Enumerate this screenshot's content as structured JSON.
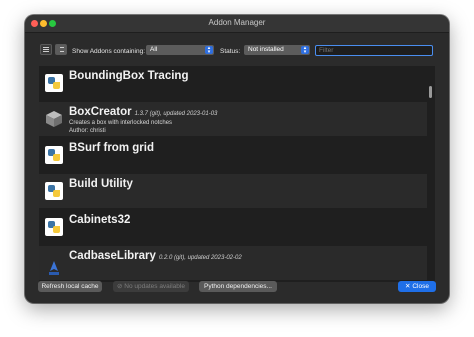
{
  "window": {
    "title": "Addon Manager"
  },
  "toolbar": {
    "show_label": "Show Addons containing:",
    "show_value": "All",
    "status_label": "Status:",
    "status_value": "Not installed",
    "filter_placeholder": "Filter"
  },
  "addons": [
    {
      "name": "BoundingBox Tracing",
      "meta": "",
      "description": "",
      "author": "",
      "icon": "python-icon"
    },
    {
      "name": "BoxCreator",
      "meta": "1.3.7 (git), updated 2023-01-03",
      "description": "Creates a box with interlocked notches",
      "author": "Author: christi",
      "icon": "box-icon"
    },
    {
      "name": "BSurf from grid",
      "meta": "",
      "description": "",
      "author": "",
      "icon": "python-icon"
    },
    {
      "name": "Build Utility",
      "meta": "",
      "description": "",
      "author": "",
      "icon": "python-icon"
    },
    {
      "name": "Cabinets32",
      "meta": "",
      "description": "",
      "author": "",
      "icon": "python-icon"
    },
    {
      "name": "CadbaseLibrary",
      "meta": "0.2.0 (git), updated 2023-02-02",
      "description": "",
      "author": "",
      "icon": "cadbase-icon"
    }
  ],
  "buttons": {
    "refresh": "Refresh local cache",
    "no_updates": "No updates available",
    "python_deps": "Python dependencies...",
    "close": "Close"
  },
  "colors": {
    "accent": "#1f6fe8",
    "window_bg": "#2b2b2b"
  }
}
